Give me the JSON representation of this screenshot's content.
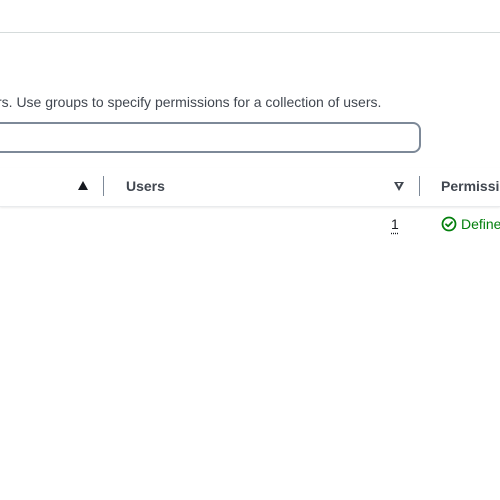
{
  "header": {
    "description": "rs. Use groups to specify permissions for a collection of users."
  },
  "search": {
    "placeholder": "",
    "value": ""
  },
  "table": {
    "columns": [
      {
        "label": "",
        "sort": "ascending"
      },
      {
        "label": "Users",
        "sort": "descending"
      },
      {
        "label": "Permissi",
        "sort": "none"
      }
    ],
    "rows": [
      {
        "users": "1",
        "permissions_status": "Define",
        "permissions_icon": "check-circle-icon"
      }
    ]
  },
  "colors": {
    "success": "#037f0c",
    "border": "#7d8998",
    "text": "#16191f",
    "muted_text": "#414750"
  }
}
